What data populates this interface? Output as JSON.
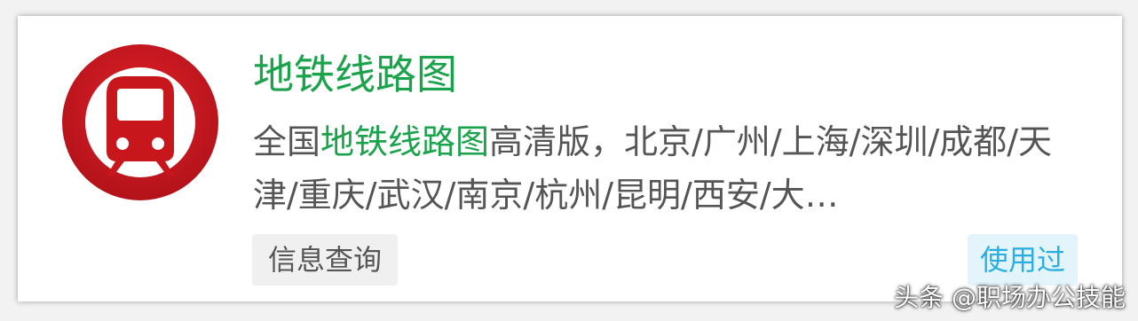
{
  "app": {
    "title": "地铁线路图",
    "description_parts": [
      "全国",
      "地铁线路图",
      "高清版，北京/广州/上海/深圳/成都/天津/重庆/武汉/南京/杭州/昆明/西安/大…"
    ],
    "icon": "subway-train-icon",
    "category_tag": "信息查询",
    "used_badge": "使用过"
  },
  "watermark": "头条 @职场办公技能",
  "colors": {
    "title_green": "#1aa34a",
    "icon_red": "#c8171c",
    "badge_blue": "#29aee3",
    "badge_bg": "#e3f5fb",
    "text_gray": "#555555"
  }
}
